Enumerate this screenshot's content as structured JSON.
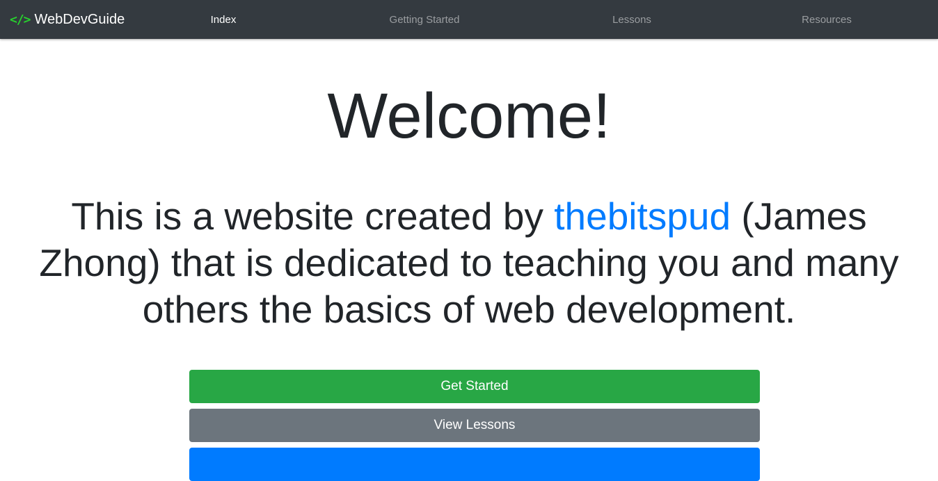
{
  "nav": {
    "brand_icon": "</>",
    "brand": "WebDevGuide",
    "links": [
      {
        "label": "Index",
        "active": true
      },
      {
        "label": "Getting Started",
        "active": false
      },
      {
        "label": "Lessons",
        "active": false
      },
      {
        "label": "Resources",
        "active": false
      }
    ]
  },
  "hero": {
    "title": "Welcome!",
    "lead_before": "This is a website created by ",
    "lead_link": "thebitspud",
    "lead_after": " (James Zhong) that is dedicated to teaching you and many others the basics of web development."
  },
  "buttons": {
    "get_started": "Get Started",
    "view_lessons": "View Lessons",
    "third": ""
  },
  "colors": {
    "navbar": "#343a40",
    "brand_icon": "#28d12e",
    "link": "#007bff",
    "success": "#28a745",
    "secondary": "#6c757d",
    "primary": "#007bff"
  }
}
